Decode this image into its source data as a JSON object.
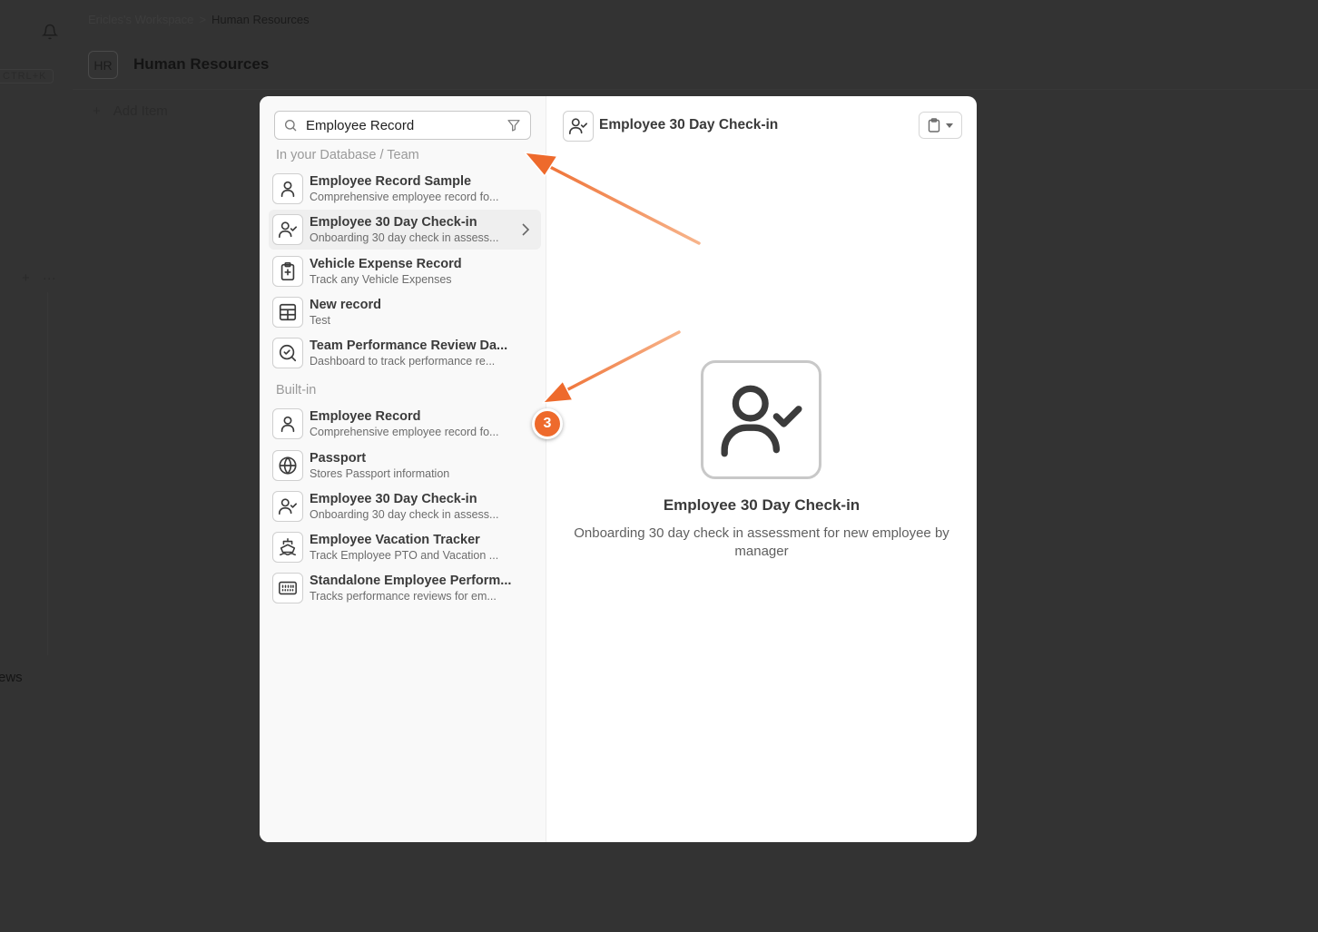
{
  "background": {
    "breadcrumb": {
      "workspace": "Ericles's Workspace",
      "separator": ">",
      "current": "Human Resources"
    },
    "shortcut": "CTRL+K",
    "page_badge": "HR",
    "page_title": "Human Resources",
    "add_item_icon": "+",
    "add_item_label": "Add Item",
    "plus_icon": "+",
    "more_icon": "···",
    "views_label": "ews"
  },
  "search": {
    "value": "Employee Record",
    "placeholder": ""
  },
  "sections": {
    "team": "In your Database / Team",
    "builtin": "Built-in"
  },
  "team_items": [
    {
      "icon": "user-icon",
      "title": "Employee Record Sample",
      "subtitle": "Comprehensive employee record fo..."
    },
    {
      "icon": "user-check-icon",
      "title": "Employee 30 Day Check-in",
      "subtitle": "Onboarding 30 day check in assess..."
    },
    {
      "icon": "clipboard-plus-icon",
      "title": "Vehicle Expense Record",
      "subtitle": "Track any Vehicle Expenses"
    },
    {
      "icon": "table-icon",
      "title": "New record",
      "subtitle": "Test"
    },
    {
      "icon": "search-check-icon",
      "title": "Team Performance Review Da...",
      "subtitle": "Dashboard to track performance re..."
    }
  ],
  "builtin_items": [
    {
      "icon": "user-icon",
      "title": "Employee Record",
      "subtitle": "Comprehensive employee record fo..."
    },
    {
      "icon": "globe-icon",
      "title": "Passport",
      "subtitle": "Stores Passport information"
    },
    {
      "icon": "user-check-icon",
      "title": "Employee 30 Day Check-in",
      "subtitle": "Onboarding 30 day check in assess..."
    },
    {
      "icon": "ship-icon",
      "title": "Employee Vacation Tracker",
      "subtitle": "Track Employee PTO and Vacation ..."
    },
    {
      "icon": "keyboard-icon",
      "title": "Standalone Employee Perform...",
      "subtitle": "Tracks performance reviews for em..."
    }
  ],
  "preview": {
    "icon": "user-check-icon",
    "header_title": "Employee 30 Day Check-in",
    "title": "Employee 30 Day Check-in",
    "description": "Onboarding 30 day check in assessment for new employee by manager"
  },
  "annotation": {
    "step_number": "3",
    "accent_color": "#ee6a2c"
  }
}
